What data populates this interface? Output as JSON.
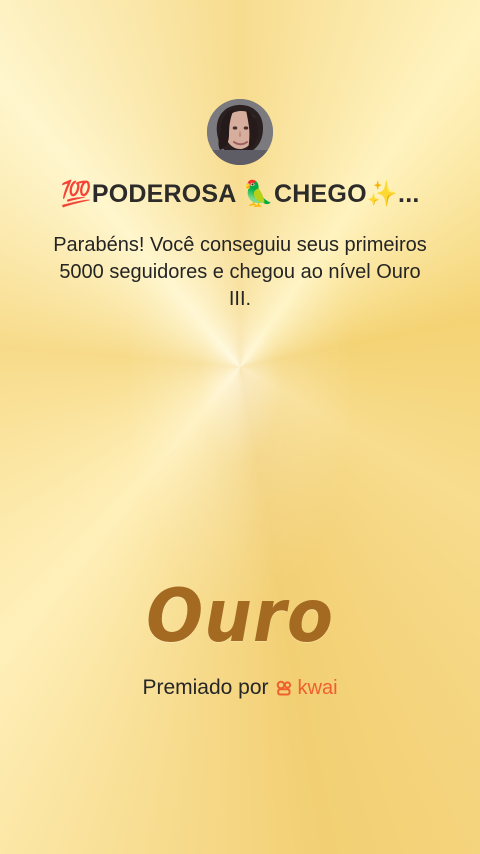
{
  "profile": {
    "display_name": "💯PODEROSA 🦜CHEGO✨...",
    "avatar_icon": "user-avatar-photo"
  },
  "message": {
    "text": "Parabéns! Você conseguiu seus primeiros 5000 seguidores e chegou ao nível Ouro III."
  },
  "award": {
    "tier_label": "Ouro",
    "credit_label": "Premiado por",
    "brand_name": "kwai"
  },
  "theme": {
    "background": "#f7dc8f",
    "gold_text": "#a56a21",
    "brand_accent": "#f05f2f",
    "body_text": "#242424"
  }
}
